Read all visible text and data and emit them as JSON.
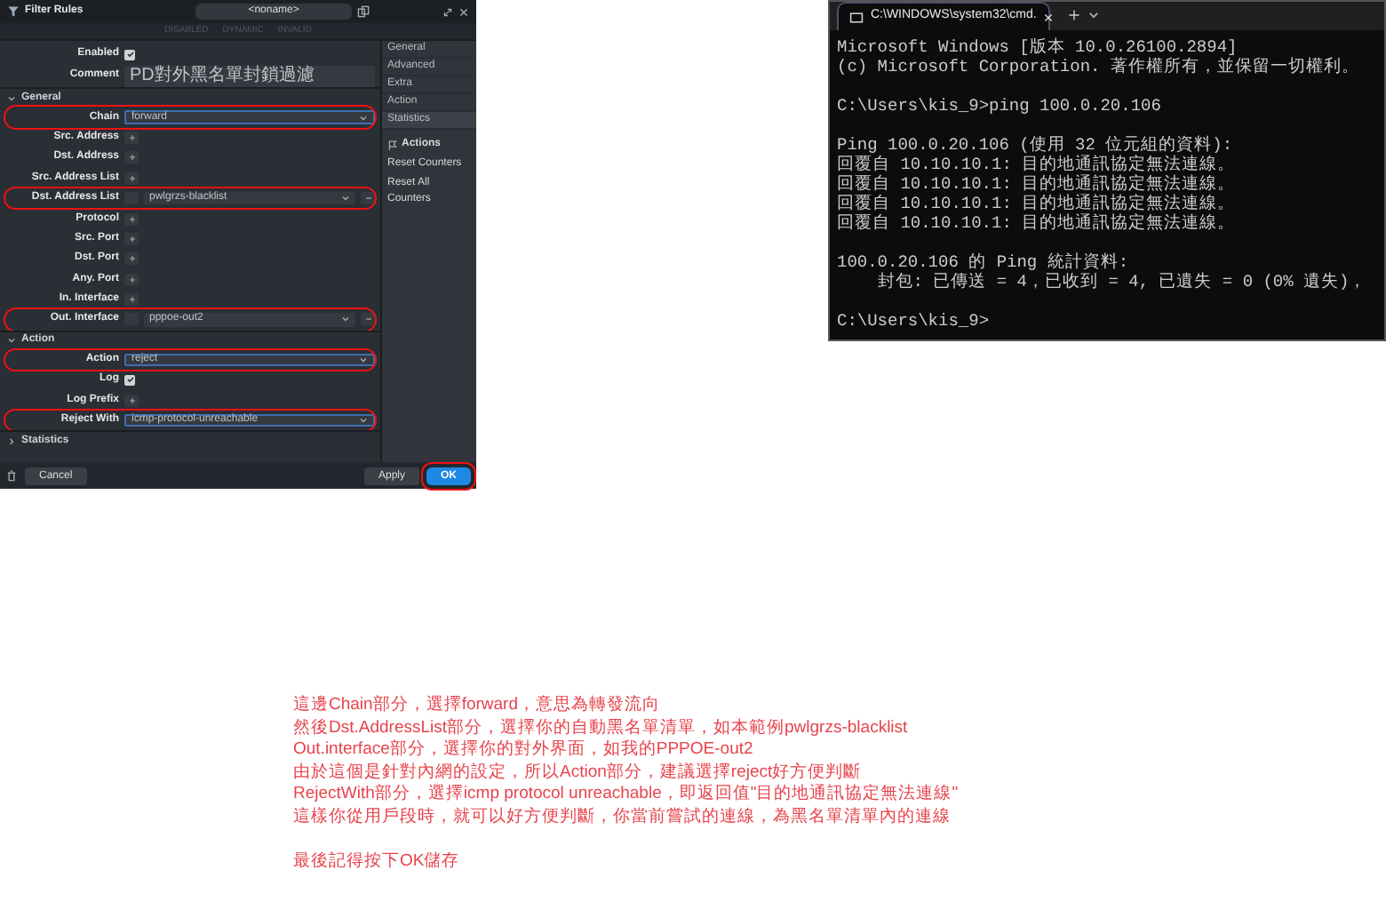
{
  "dialog": {
    "title": "Filter Rules",
    "profile": "<noname>",
    "flags": [
      "DISABLED",
      "DYNAMIC",
      "INVALID"
    ],
    "fields": [
      {
        "kind": "checkbox",
        "label": "Enabled",
        "checked": true,
        "highlighted": false
      },
      {
        "kind": "text",
        "label": "Comment",
        "value": "PD對外黑名單封鎖過濾",
        "highlighted": false
      },
      {
        "kind": "section",
        "label": "General",
        "expanded": true
      },
      {
        "kind": "select",
        "label": "Chain",
        "value": "forward",
        "highlighted": true
      },
      {
        "kind": "add",
        "label": "Src. Address",
        "highlighted": false
      },
      {
        "kind": "add",
        "label": "Dst. Address",
        "highlighted": false
      },
      {
        "kind": "add",
        "label": "Src. Address List",
        "highlighted": false
      },
      {
        "kind": "list",
        "label": "Dst. Address List",
        "value": "pwlgrzs-blacklist",
        "highlighted": true
      },
      {
        "kind": "add",
        "label": "Protocol",
        "highlighted": false
      },
      {
        "kind": "add",
        "label": "Src. Port",
        "highlighted": false
      },
      {
        "kind": "add",
        "label": "Dst. Port",
        "highlighted": false
      },
      {
        "kind": "add",
        "label": "Any. Port",
        "highlighted": false
      },
      {
        "kind": "add",
        "label": "In. Interface",
        "highlighted": false
      },
      {
        "kind": "list",
        "label": "Out. Interface",
        "value": "pppoe-out2",
        "highlighted": true
      },
      {
        "kind": "section",
        "label": "Action",
        "expanded": true
      },
      {
        "kind": "select",
        "label": "Action",
        "value": "reject",
        "highlighted": true
      },
      {
        "kind": "checkbox",
        "label": "Log",
        "checked": true,
        "highlighted": false
      },
      {
        "kind": "add",
        "label": "Log Prefix",
        "highlighted": false
      },
      {
        "kind": "select",
        "label": "Reject With",
        "value": "icmp-protocol-unreachable",
        "highlighted": true
      },
      {
        "kind": "section",
        "label": "Statistics",
        "expanded": false
      }
    ],
    "tabs": [
      {
        "label": "General",
        "selected": false
      },
      {
        "label": "Advanced",
        "selected": false
      },
      {
        "label": "Extra",
        "selected": false
      },
      {
        "label": "Action",
        "selected": false
      },
      {
        "label": "Statistics",
        "selected": true
      }
    ],
    "actions_title": "Actions",
    "actions": [
      "Reset Counters",
      "Reset All Counters"
    ],
    "buttons": [
      {
        "label": "Cancel",
        "kind": "secondary",
        "highlighted": false
      },
      {
        "label": "Apply",
        "kind": "secondary",
        "highlighted": false
      },
      {
        "label": "OK",
        "kind": "primary",
        "highlighted": true
      }
    ]
  },
  "terminal": {
    "tab_title": "C:\\WINDOWS\\system32\\cmd.",
    "blocks": [
      [
        "Microsoft Windows [版本 10.0.26100.2894]",
        "(c) Microsoft Corporation. 著作權所有，並保留一切權利。"
      ],
      [
        "C:\\Users\\kis_9>ping 100.0.20.106"
      ],
      [
        "Ping 100.0.20.106 (使用 32 位元組的資料):",
        "回覆自 10.10.10.1: 目的地通訊協定無法連線。",
        "回覆自 10.10.10.1: 目的地通訊協定無法連線。",
        "回覆自 10.10.10.1: 目的地通訊協定無法連線。",
        "回覆自 10.10.10.1: 目的地通訊協定無法連線。"
      ],
      [
        "100.0.20.106 的 Ping 統計資料:",
        "    封包: 已傳送 = 4，已收到 = 4, 已遺失 = 0 (0% 遺失)，"
      ],
      [
        "C:\\Users\\kis_9>"
      ]
    ]
  },
  "notes": [
    [
      "這邊Chain部分，選擇forward，意思為轉發流向",
      "然後Dst.AddressList部分，選擇你的自動黑名單清單，如本範例pwlgrzs-blacklist",
      "Out.interface部分，選擇你的對外界面，如我的PPPOE-out2",
      "由於這個是針對內網的設定，所以Action部分，建議選擇reject好方便判斷",
      "RejectWith部分，選擇icmp protocol unreachable，即返回值\"目的地通訊協定無法連線\"",
      "這樣你從用戶段時，就可以好方便判斷，你當前嘗試的連線，為黑名單清單內的連線"
    ],
    [
      "最後記得按下OK儲存"
    ]
  ]
}
